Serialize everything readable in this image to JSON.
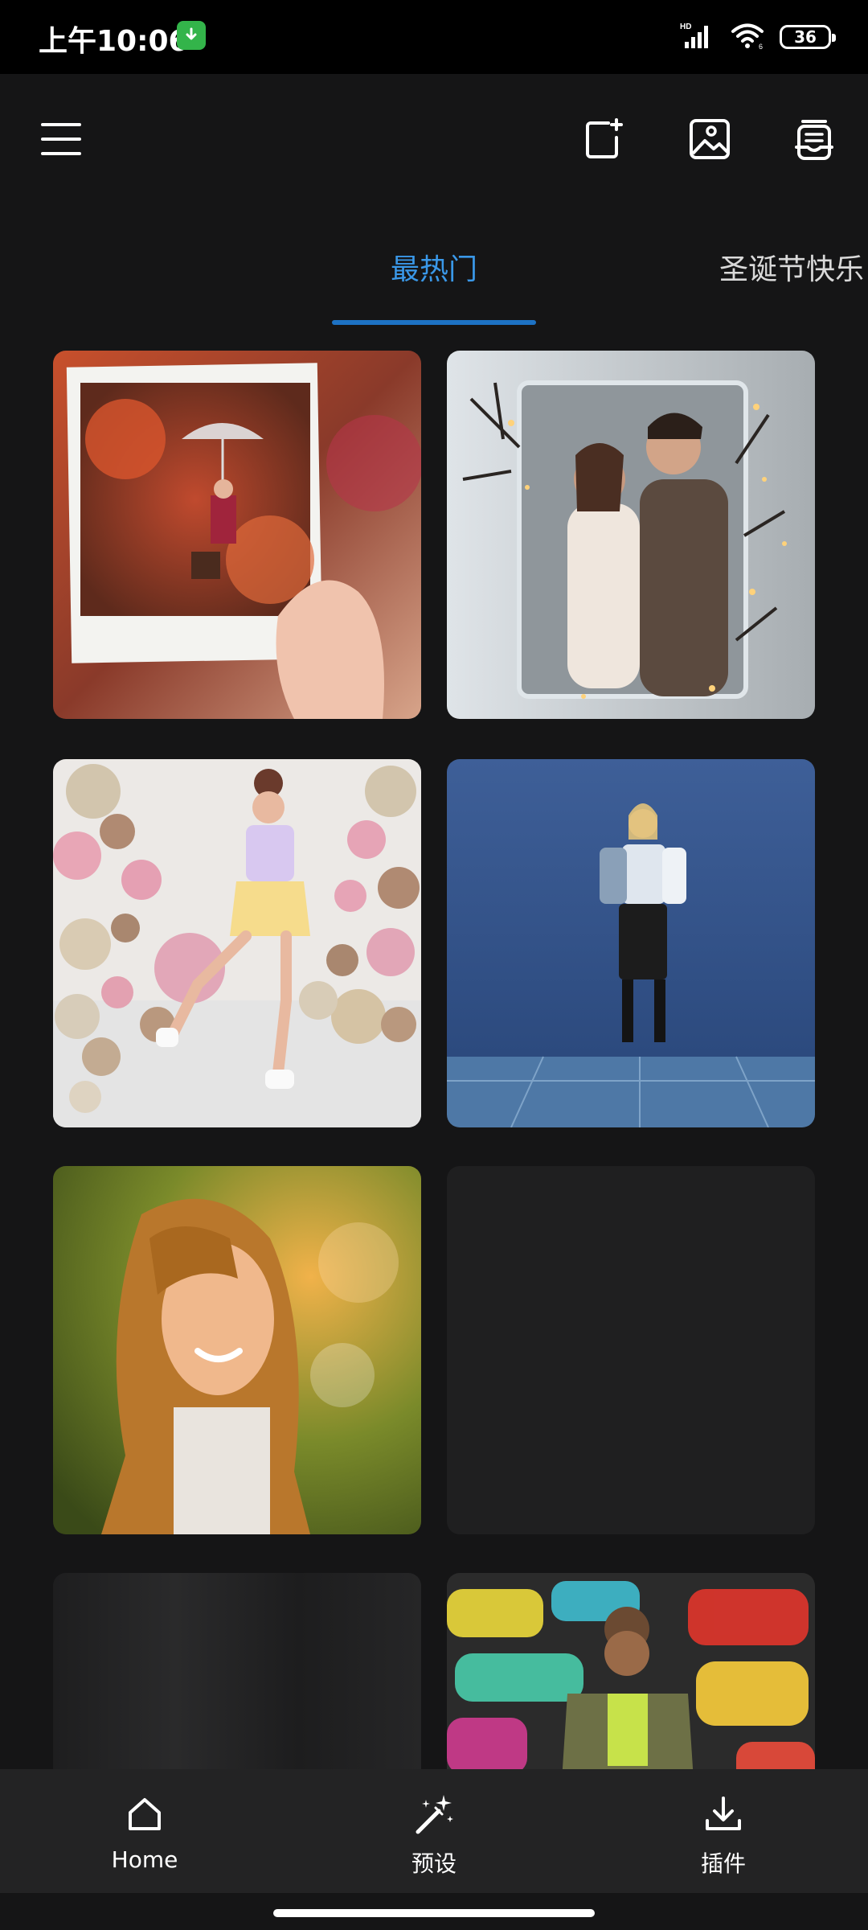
{
  "status": {
    "time": "上午10:06",
    "battery": "36",
    "icons": [
      "download-notification-icon",
      "hd-signal-icon",
      "wifi-icon",
      "battery-icon"
    ]
  },
  "toolbar": {
    "icons": [
      "menu-icon",
      "new-canvas-icon",
      "image-icon",
      "templates-icon"
    ]
  },
  "tabs": [
    {
      "label": "最热门",
      "active": true
    },
    {
      "label": "圣诞节快乐",
      "active": false
    }
  ],
  "grid": {
    "items": [
      {
        "name": "autumn-polaroid-template",
        "loaded": true
      },
      {
        "name": "winter-couple-frame-template",
        "loaded": true
      },
      {
        "name": "balloon-party-template",
        "loaded": true
      },
      {
        "name": "blue-studio-fashion-template",
        "loaded": true
      },
      {
        "name": "sunlit-portrait-template",
        "loaded": true
      },
      {
        "name": "loading-placeholder",
        "loaded": false
      },
      {
        "name": "loading-placeholder",
        "loaded": false
      },
      {
        "name": "graffiti-wall-template",
        "loaded": true
      }
    ]
  },
  "bottom_nav": {
    "items": [
      {
        "label": "Home",
        "icon": "home-icon"
      },
      {
        "label": "预设",
        "icon": "magic-wand-icon"
      },
      {
        "label": "插件",
        "icon": "download-icon"
      }
    ]
  },
  "colors": {
    "background": "#151516",
    "accent": "#3a98e8",
    "nav_bg": "#232324"
  }
}
